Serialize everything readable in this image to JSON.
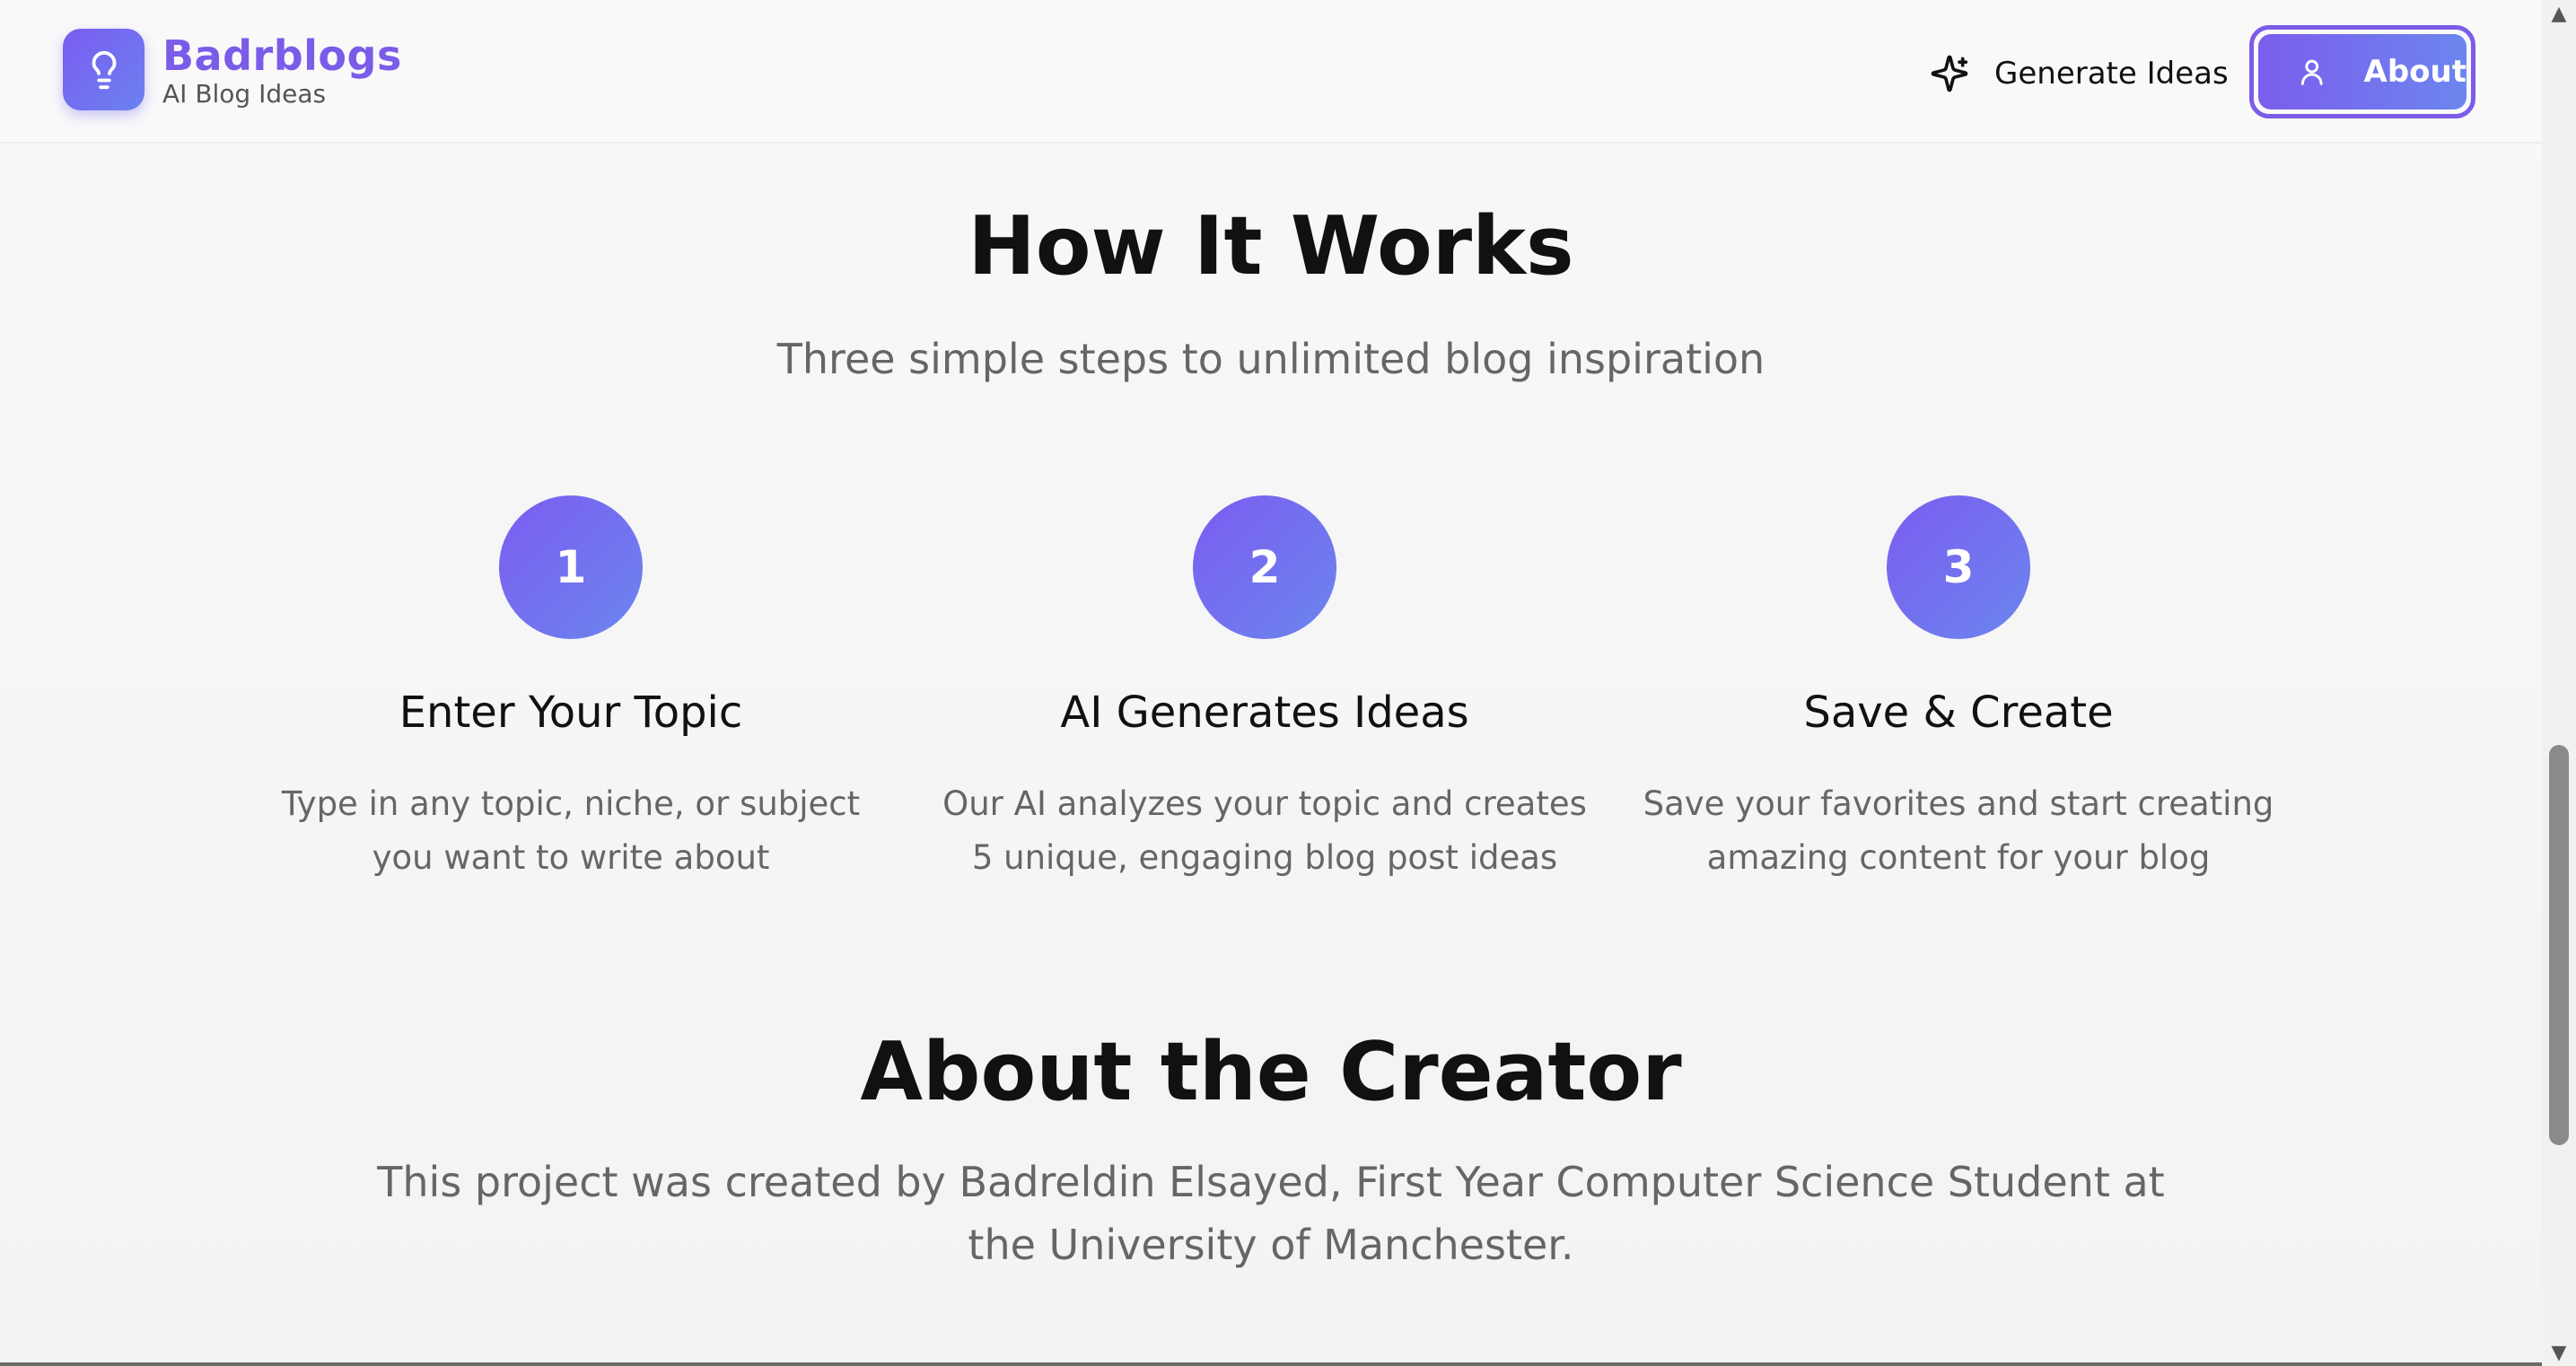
{
  "header": {
    "brand_name": "Badrblogs",
    "brand_tagline": "AI Blog Ideas",
    "nav": {
      "generate_label": "Generate Ideas",
      "about_label": "About"
    }
  },
  "how_it_works": {
    "title": "How It Works",
    "subtitle": "Three simple steps to unlimited blog inspiration",
    "steps": [
      {
        "number": "1",
        "title": "Enter Your Topic",
        "description": "Type in any topic, niche, or subject you want to write about"
      },
      {
        "number": "2",
        "title": "AI Generates Ideas",
        "description": "Our AI analyzes your topic and creates 5 unique, engaging blog post ideas"
      },
      {
        "number": "3",
        "title": "Save & Create",
        "description": "Save your favorites and start creating amazing content for your blog"
      }
    ]
  },
  "about": {
    "title": "About the Creator",
    "text": "This project was created by Badreldin Elsayed, First Year Computer Science Student at the University of Manchester."
  },
  "icons": {
    "logo": "lightbulb-icon",
    "generate": "sparkles-icon",
    "about": "user-icon"
  },
  "colors": {
    "accent": "#7b5cf0",
    "accent_secondary": "#6b86ee",
    "text": "#111111",
    "muted": "#666666"
  }
}
